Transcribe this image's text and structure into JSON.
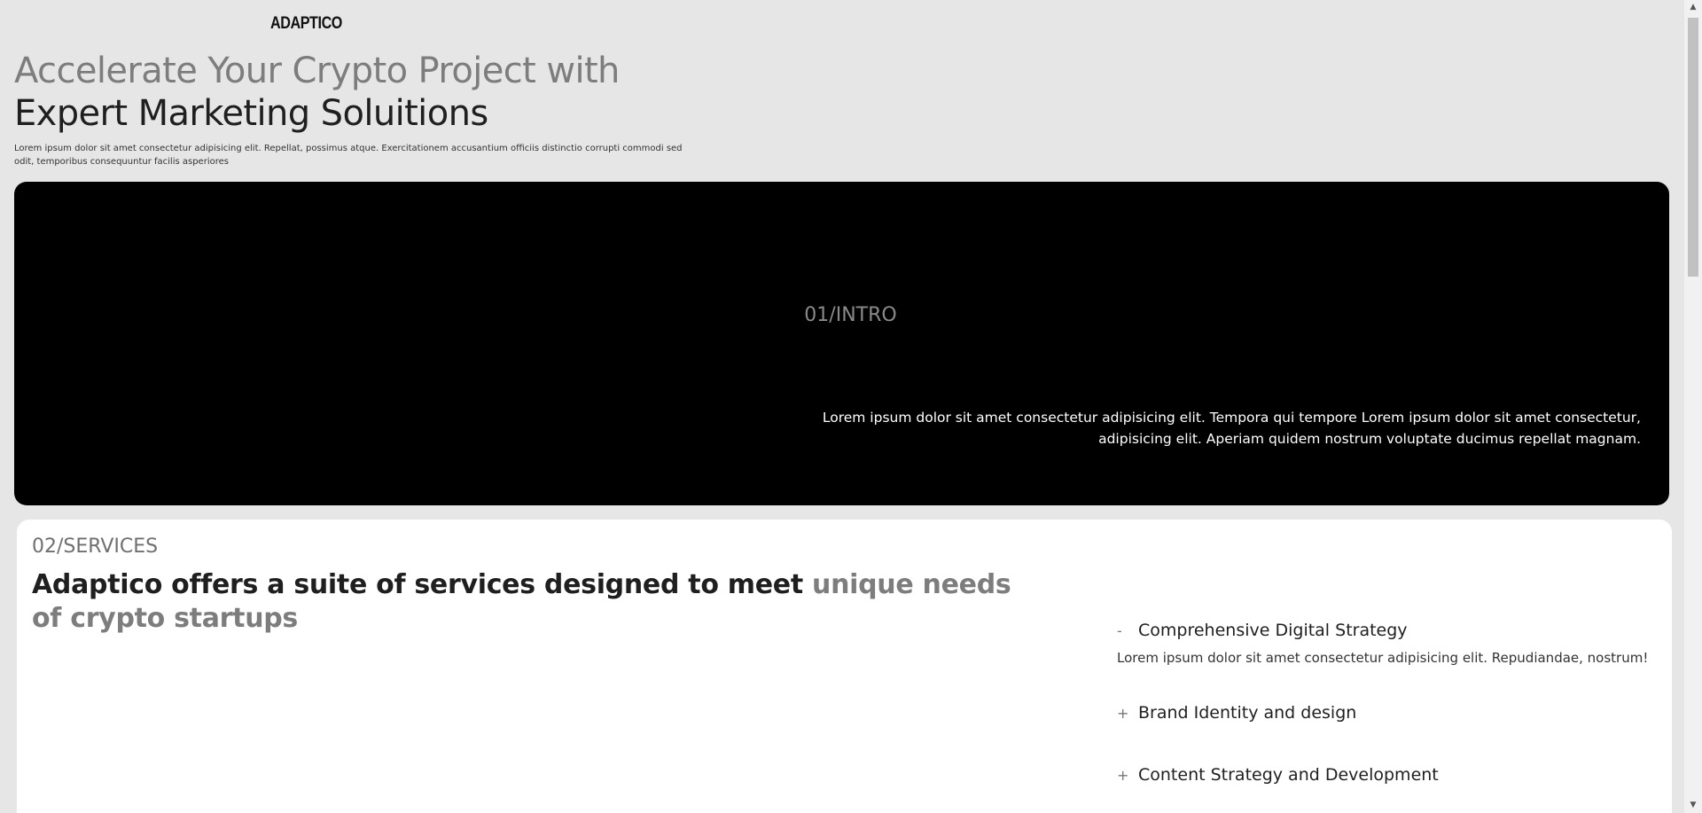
{
  "header": {
    "logo": "ADAPTICO"
  },
  "hero": {
    "title_muted": "Accelerate Your Crypto Project with ",
    "title_dark": "Expert Marketing Soluitions",
    "description": "Lorem ipsum dolor sit amet consectetur adipisicing elit. Repellat, possimus atque. Exercitationem accusantium officiis distinctio corrupti commodi sed odit, temporibus consequuntur facilis asperiores"
  },
  "intro": {
    "tag": "01/INTRO",
    "text": "Lorem ipsum dolor sit amet consectetur adipisicing elit. Tempora qui tempore Lorem ipsum dolor sit amet consectetur, adipisicing elit. Aperiam quidem nostrum voluptate ducimus repellat magnam."
  },
  "services": {
    "tag": "02/SERVICES",
    "title_dark": "Adaptico offers a suite of services designed to meet ",
    "title_muted": "unique needs of crypto startups",
    "items": [
      {
        "sign": "-",
        "title": "Comprehensive Digital Strategy",
        "body": "Lorem ipsum dolor sit amet consectetur adipisicing elit. Repudiandae, nostrum!"
      },
      {
        "sign": "+",
        "title": "Brand Identity and design"
      },
      {
        "sign": "+",
        "title": "Content Strategy and Development"
      }
    ]
  },
  "scrollbar": {
    "up_icon": "▲",
    "down_icon": "▼"
  },
  "colors": {
    "background": "#e6e6e6",
    "panel_dark": "#000000",
    "panel_light": "#ffffff",
    "muted_text": "#7d7d7d"
  }
}
